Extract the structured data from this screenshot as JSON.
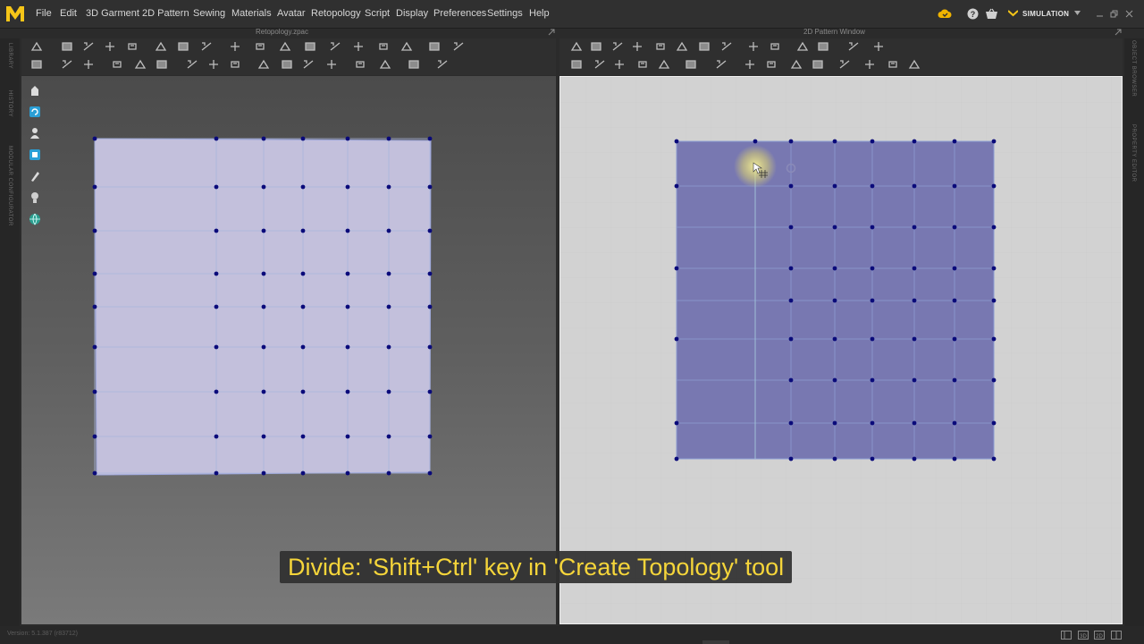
{
  "app": {
    "menu": [
      "File",
      "Edit",
      "3D Garment",
      "2D Pattern",
      "Sewing",
      "Materials",
      "Avatar",
      "Retopology",
      "Script",
      "Display",
      "Preferences",
      "Settings",
      "Help"
    ],
    "mode_label": "SIMULATION"
  },
  "windows": {
    "left_title": "Retopology.zpac",
    "right_title": "2D Pattern Window"
  },
  "side_panels": {
    "left": [
      "LIBRARY",
      "HISTORY",
      "MODULAR CONFIGURATOR"
    ],
    "right": [
      "OBJECT BROWSER",
      "PROPERTY EDITOR"
    ]
  },
  "caption": "Divide: 'Shift+Ctrl' key in 'Create Topology' tool",
  "status": {
    "version": "Version: 5.1.387 (r83712)"
  },
  "colors": {
    "pattern_3d_fill": "#c3c0dc",
    "pattern_2d_fill": "#7878b1",
    "vertex": "#0a0a7a",
    "caption_text": "#f5d53a",
    "logo": "#f5c518"
  }
}
